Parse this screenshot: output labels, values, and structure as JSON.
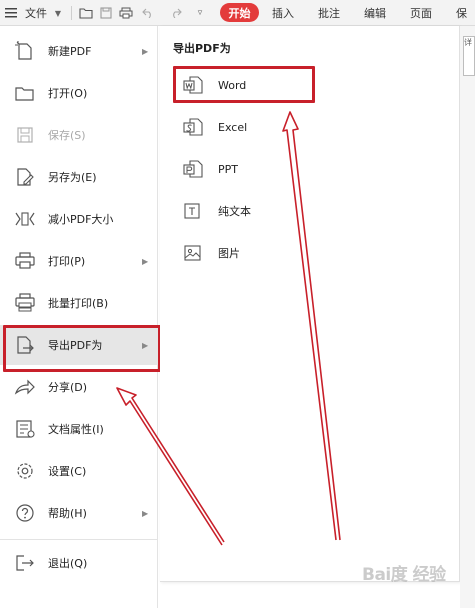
{
  "toolbar": {
    "file_label": "文件",
    "tabs": [
      {
        "label": "开始",
        "active": true
      },
      {
        "label": "插入"
      },
      {
        "label": "批注"
      },
      {
        "label": "编辑"
      },
      {
        "label": "页面"
      },
      {
        "label": "保"
      }
    ]
  },
  "file_menu": {
    "items": [
      {
        "label": "新建PDF",
        "icon": "new-pdf-icon",
        "has_submenu": true
      },
      {
        "label": "打开(O)",
        "icon": "folder-open-icon"
      },
      {
        "label": "保存(S)",
        "icon": "save-icon",
        "disabled": true
      },
      {
        "label": "另存为(E)",
        "icon": "save-as-icon"
      },
      {
        "label": "减小PDF大小",
        "icon": "compress-icon"
      },
      {
        "label": "打印(P)",
        "icon": "printer-icon",
        "has_submenu": true
      },
      {
        "label": "批量打印(B)",
        "icon": "batch-print-icon"
      },
      {
        "label": "导出PDF为",
        "icon": "export-pdf-icon",
        "has_submenu": true,
        "selected": true
      },
      {
        "label": "分享(D)",
        "icon": "share-icon"
      },
      {
        "label": "文档属性(I)",
        "icon": "properties-icon"
      },
      {
        "label": "设置(C)",
        "icon": "gear-icon"
      },
      {
        "label": "帮助(H)",
        "icon": "help-icon",
        "has_submenu": true
      },
      {
        "label": "退出(Q)",
        "icon": "exit-icon"
      }
    ]
  },
  "export_submenu": {
    "title": "导出PDF为",
    "items": [
      {
        "label": "Word",
        "icon": "word-doc-icon",
        "highlighted": true
      },
      {
        "label": "Excel",
        "icon": "excel-doc-icon"
      },
      {
        "label": "PPT",
        "icon": "ppt-doc-icon"
      },
      {
        "label": "纯文本",
        "icon": "text-doc-icon"
      },
      {
        "label": "图片",
        "icon": "image-icon"
      }
    ]
  },
  "right_strip_label": "详",
  "watermark": "Bai度 经验",
  "colors": {
    "accent": "#e33b3b",
    "annotation": "#c8202a",
    "selected_bg": "#e6e6e6"
  }
}
